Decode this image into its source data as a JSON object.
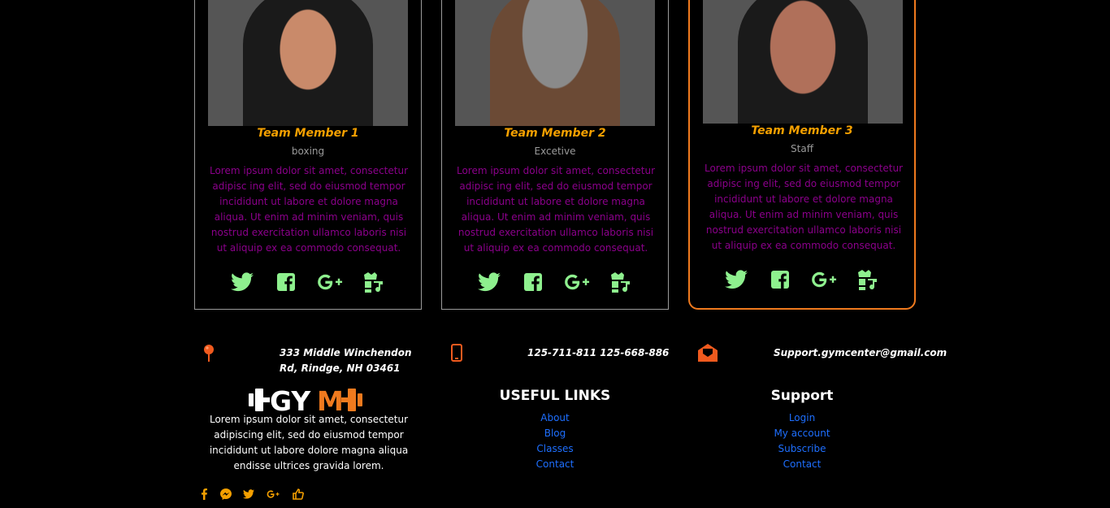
{
  "team": [
    {
      "name": "Team Member 1",
      "role": "boxing",
      "desc": "Lorem ipsum dolor sit amet, consectetur adipisc ing elit, sed do eiusmod tempor incididunt ut labore et dolore magna aliqua. Ut enim ad minim veniam, quis nostrud exercitation ullamco laboris nisi ut aliquip ex ea commodo consequat."
    },
    {
      "name": "Team Member 2",
      "role": "Excetive",
      "desc": "Lorem ipsum dolor sit amet, consectetur adipisc ing elit, sed do eiusmod tempor incididunt ut labore et dolore magna aliqua. Ut enim ad minim veniam, quis nostrud exercitation ullamco laboris nisi ut aliquip ex ea commodo consequat."
    },
    {
      "name": "Team Member 3",
      "role": "Staff",
      "desc": "Lorem ipsum dolor sit amet, consectetur adipisc ing elit, sed do eiusmod tempor incididunt ut labore et dolore magna aliqua. Ut enim ad minim veniam, quis nostrud exercitation ullamco laboris nisi ut aliquip ex ea commodo consequat."
    }
  ],
  "contact": {
    "address_line1": "333 Middle Winchendon",
    "address_line2": "Rd, Rindge, NH 03461",
    "phone": "125-711-811 125-668-886",
    "email": "Support.gymcenter@gmail.com"
  },
  "footer": {
    "logo_left": "GY",
    "logo_right": "M",
    "about": "Lorem ipsum dolor sit amet, consectetur adipiscing elit, sed do eiusmod tempor incididunt ut labore dolore magna aliqua endisse ultrices gravida lorem.",
    "useful_title": "USEFUL LINKS",
    "useful_links": [
      "About",
      "Blog",
      "Classes",
      "Contact"
    ],
    "support_title": "Support",
    "support_links": [
      "Login",
      "My account",
      "Subscribe",
      "Contact"
    ]
  },
  "colors": {
    "accent": "#f5a000",
    "orange": "#f07a1e",
    "icon_green": "#8ef08e",
    "desc_purple": "#8b008b",
    "link_blue": "#1e6fff"
  },
  "icons": {
    "card_social": [
      "twitter-icon",
      "facebook-icon",
      "google-plus-icon",
      "music-icon"
    ],
    "footer_social": [
      "facebook-icon",
      "messenger-icon",
      "twitter-icon",
      "google-plus-icon",
      "thumbs-up-icon"
    ],
    "contact": [
      "map-pin-icon",
      "phone-icon",
      "mail-icon"
    ]
  }
}
